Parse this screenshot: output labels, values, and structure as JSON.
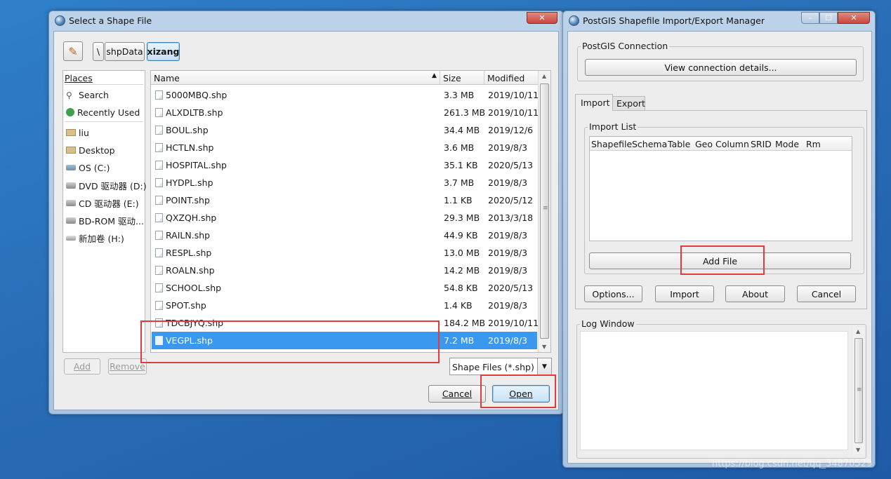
{
  "watermark": "https://blog.csdn.net/qq_34870529",
  "colors": {
    "selection": "#3a99ee",
    "highlight": "#e53a3a",
    "close_button": "#c9463d"
  },
  "file_dialog": {
    "title": "Select a Shape File",
    "path": {
      "root_sep": "\\",
      "segments": [
        "shpData",
        "xizang"
      ],
      "active": "xizang"
    },
    "places": {
      "header": "Places",
      "items": [
        {
          "label": "Search",
          "icon": "search-icon"
        },
        {
          "label": "Recently Used",
          "icon": "recent-icon"
        },
        {
          "label": "liu",
          "icon": "folder-icon"
        },
        {
          "label": "Desktop",
          "icon": "folder-icon"
        },
        {
          "label": "OS (C:)",
          "icon": "drive-icon"
        },
        {
          "label": "DVD 驱动器 (D:)",
          "icon": "optical-drive-icon"
        },
        {
          "label": "CD 驱动器 (E:)",
          "icon": "optical-drive-icon"
        },
        {
          "label": "BD-ROM 驱动...",
          "icon": "optical-drive-icon"
        },
        {
          "label": "新加卷 (H:)",
          "icon": "drive-icon"
        }
      ],
      "add_label": "Add",
      "remove_label": "Remove"
    },
    "columns": {
      "name": "Name",
      "size": "Size",
      "modified": "Modified"
    },
    "files": [
      {
        "name": "5000MBQ.shp",
        "size": "3.3 MB",
        "modified": "2019/10/11"
      },
      {
        "name": "ALXDLTB.shp",
        "size": "261.3 MB",
        "modified": "2019/10/11"
      },
      {
        "name": "BOUL.shp",
        "size": "34.4 MB",
        "modified": "2019/12/6"
      },
      {
        "name": "HCTLN.shp",
        "size": "3.6 MB",
        "modified": "2019/8/3"
      },
      {
        "name": "HOSPITAL.shp",
        "size": "35.1 KB",
        "modified": "2020/5/13"
      },
      {
        "name": "HYDPL.shp",
        "size": "3.7 MB",
        "modified": "2019/8/3"
      },
      {
        "name": "POINT.shp",
        "size": "1.1 KB",
        "modified": "2020/5/12"
      },
      {
        "name": "QXZQH.shp",
        "size": "29.3 MB",
        "modified": "2013/3/18"
      },
      {
        "name": "RAILN.shp",
        "size": "44.9 KB",
        "modified": "2019/8/3"
      },
      {
        "name": "RESPL.shp",
        "size": "13.0 MB",
        "modified": "2019/8/3"
      },
      {
        "name": "ROALN.shp",
        "size": "14.2 MB",
        "modified": "2019/8/3"
      },
      {
        "name": "SCHOOL.shp",
        "size": "54.8 KB",
        "modified": "2020/5/13"
      },
      {
        "name": "SPOT.shp",
        "size": "1.4 KB",
        "modified": "2019/8/3"
      },
      {
        "name": "TDCBJYQ.shp",
        "size": "184.2 MB",
        "modified": "2019/10/11"
      },
      {
        "name": "VEGPL.shp",
        "size": "7.2 MB",
        "modified": "2019/8/3",
        "selected": true
      }
    ],
    "filter": "Shape Files (*.shp)",
    "cancel_label": "Cancel",
    "open_label": "Open"
  },
  "postgis": {
    "title": "PostGIS Shapefile Import/Export Manager",
    "connection_group": "PostGIS Connection",
    "view_connection_label": "View connection details...",
    "tabs": [
      "Import",
      "Export"
    ],
    "active_tab": "Import",
    "import_list_group": "Import List",
    "import_columns": [
      "Shapefile",
      "Schema",
      "Table",
      "Geo Column",
      "SRID",
      "Mode",
      "Rm"
    ],
    "add_file_label": "Add File",
    "buttons": {
      "options": "Options...",
      "import": "Import",
      "about": "About",
      "cancel": "Cancel"
    },
    "log_group": "Log Window"
  }
}
